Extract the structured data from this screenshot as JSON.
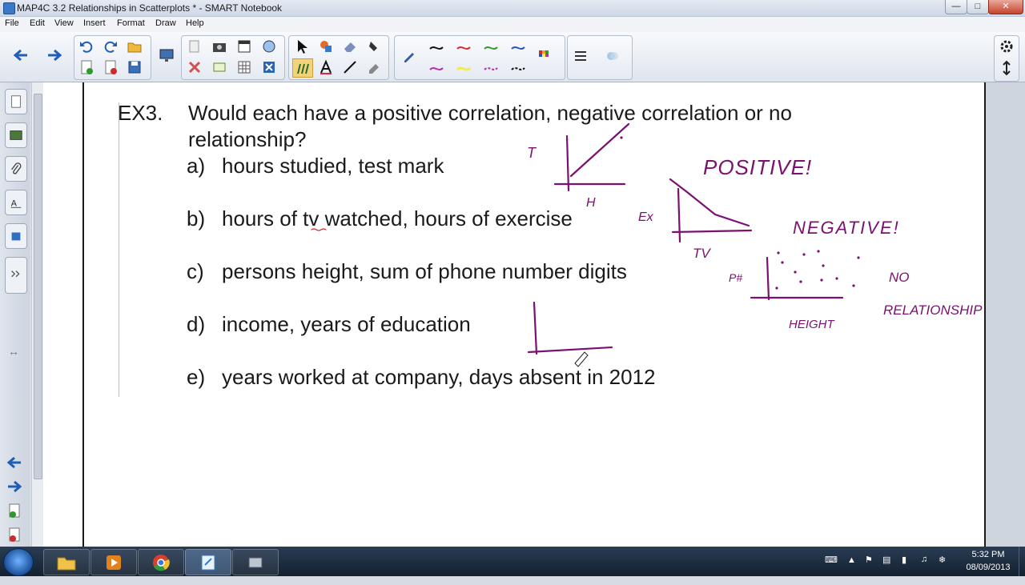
{
  "window": {
    "title": "MAP4C 3.2 Relationships in Scatterplots * - SMART Notebook"
  },
  "menu": [
    "File",
    "Edit",
    "View",
    "Insert",
    "Format",
    "Draw",
    "Help"
  ],
  "slide": {
    "heading_label": "EX3.",
    "question_line1": "Would each have a positive correlation, negative correlation or no",
    "question_line2": "relationship?",
    "items": [
      {
        "letter": "a)",
        "text": "hours studied, test mark"
      },
      {
        "letter": "b)",
        "text": "hours of tv watched, hours of exercise"
      },
      {
        "letter": "c)",
        "text": "persons height, sum of phone number digits"
      },
      {
        "letter": "d)",
        "text": "income, years of education"
      },
      {
        "letter": "e)",
        "text": "years worked at company, days absent in 2012"
      }
    ]
  },
  "handwriting": {
    "a_y": "T",
    "a_x": "H",
    "a_answer": "POSITIVE!",
    "b_y": "Ex",
    "b_x": "TV",
    "b_answer": "NEGATIVE!",
    "c_y": "P#",
    "c_x": "HEIGHT",
    "c_answer_1": "NO",
    "c_answer_2": "RELATIONSHIP"
  },
  "ink_color": "#7a1070",
  "taskbar": {
    "time": "5:32 PM",
    "date": "08/09/2013"
  }
}
